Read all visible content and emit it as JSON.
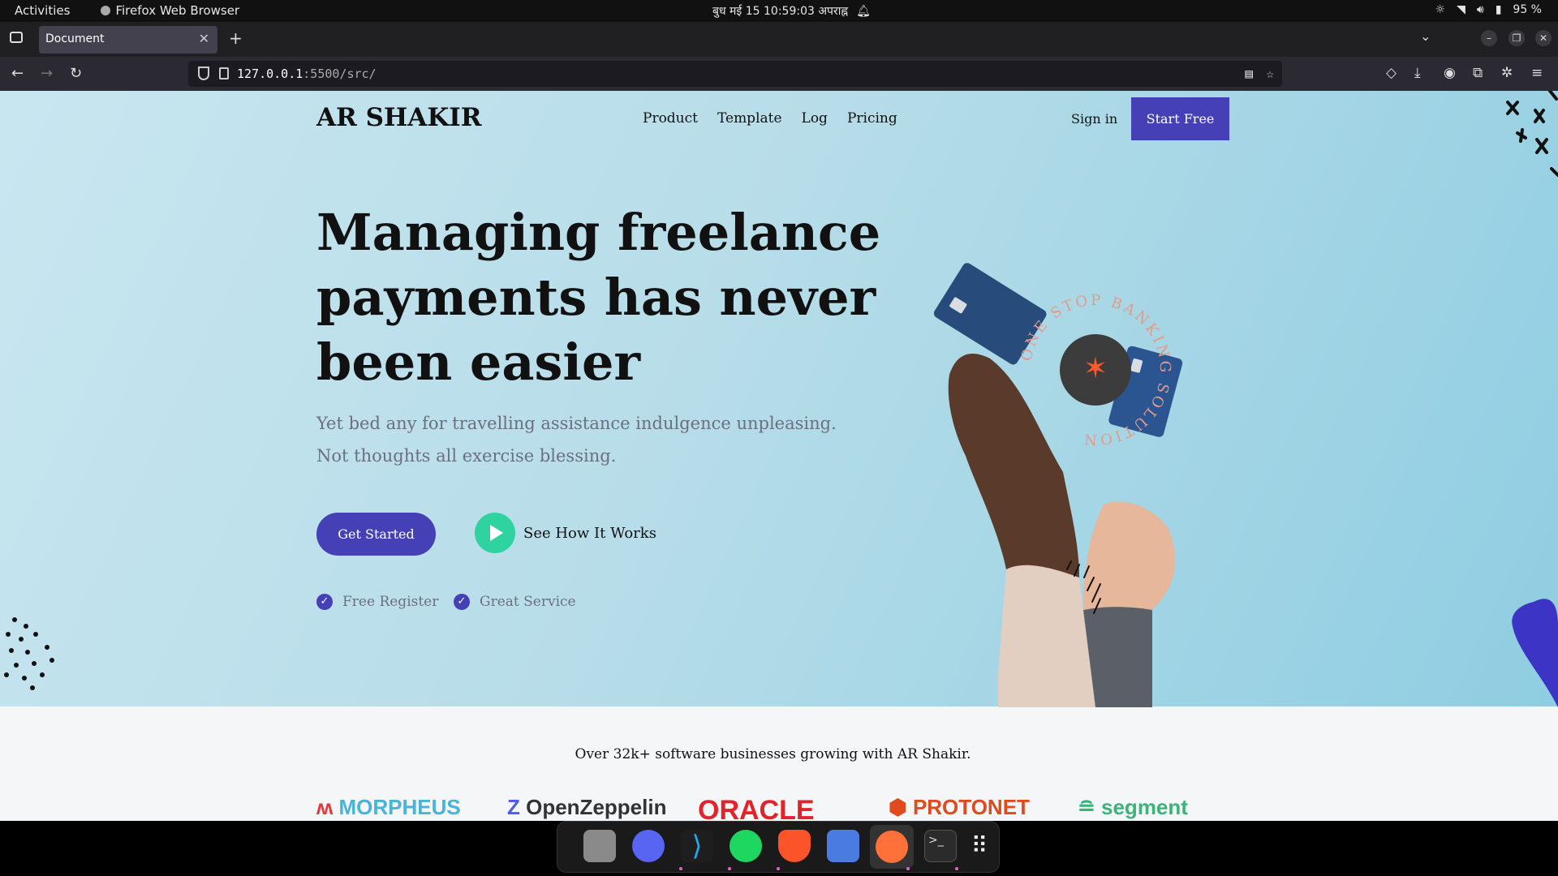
{
  "system_bar": {
    "activities": "Activities",
    "app_name": "Firefox Web Browser",
    "clock": "बुध मई 15  10:59:03 अपराह्न",
    "battery": "95 %"
  },
  "browser": {
    "tab_title": "Document",
    "url_host": "127.0.0.1",
    "url_rest": ":5500/src/"
  },
  "site": {
    "logo": "AR SHAKIR",
    "nav": [
      "Product",
      "Template",
      "Log",
      "Pricing"
    ],
    "sign_in": "Sign in",
    "start_free": "Start Free",
    "headline": "Managing freelance payments has never been easier",
    "subtext": "Yet bed any for travelling assistance indulgence unpleasing. Not thoughts all exercise blessing.",
    "get_started": "Get Started",
    "see_how": "See How It Works",
    "checks": [
      "Free Register",
      "Great Service"
    ],
    "badge_text": "ONE STOP BANKING SOLUTION",
    "trusted": "Over 32k+ software businesses growing with AR Shakir.",
    "brand_logos": [
      "MORPHEUS",
      "OpenZeppelin",
      "ORACLE",
      "PROTONET",
      "segment"
    ]
  },
  "colors": {
    "accent": "#4640b6",
    "play": "#2ed3a0"
  }
}
